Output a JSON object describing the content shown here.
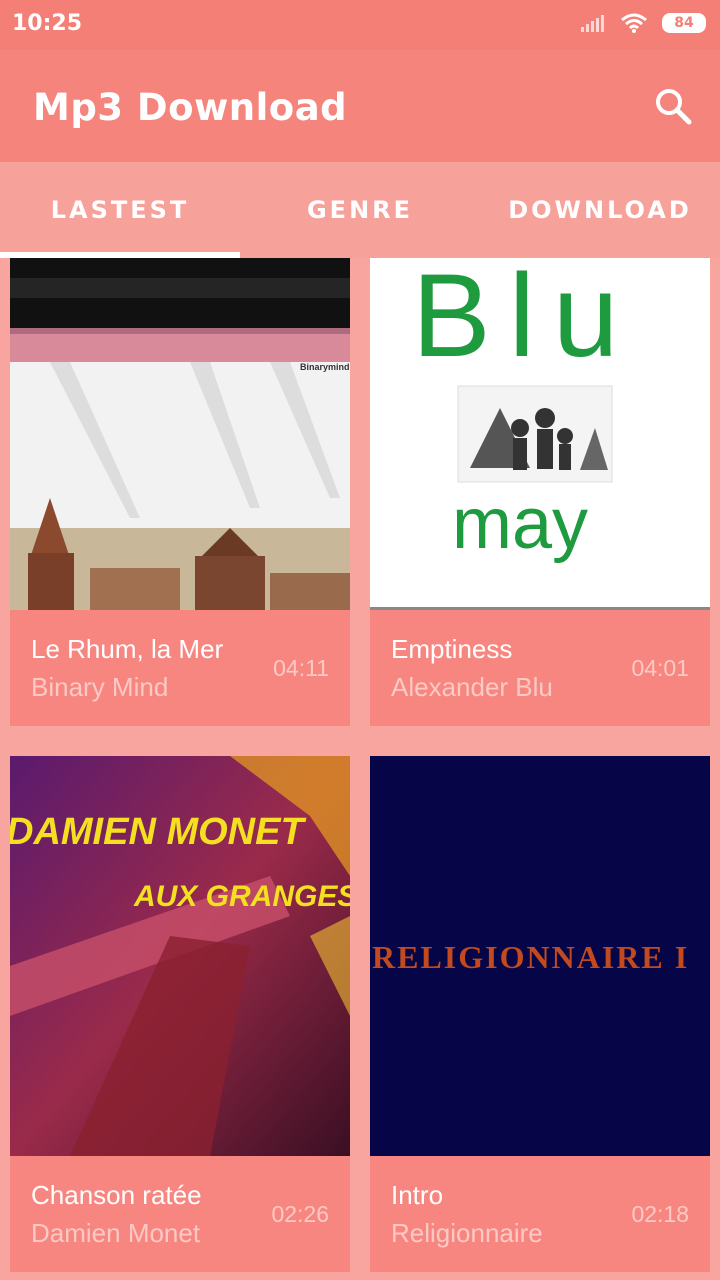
{
  "status": {
    "time": "10:25",
    "battery": "84"
  },
  "appbar": {
    "title": "Mp3 Download"
  },
  "tabs": [
    {
      "label": "LASTEST",
      "selected": true
    },
    {
      "label": "GENRE",
      "selected": false
    },
    {
      "label": "DOWNLOAD",
      "selected": false
    }
  ],
  "cards": [
    {
      "title": "Le Rhum, la Mer",
      "artist": "Binary Mind",
      "duration": "04:11",
      "cover_text": "Binarymind"
    },
    {
      "title": "Emptiness",
      "artist": "Alexander Blu",
      "duration": "04:01",
      "cover_text_top": "Blu",
      "cover_text_bottom": "may"
    },
    {
      "title": "Chanson ratée",
      "artist": "Damien Monet",
      "duration": "02:26",
      "cover_text_top": "DAMIEN MONET",
      "cover_text_bottom": "AUX GRANGES"
    },
    {
      "title": "Intro",
      "artist": "Religionnaire",
      "duration": "02:18",
      "cover_text": "RELIGIONNAIRE  I"
    }
  ],
  "colors": {
    "statusbar": "#F47F76",
    "appbar": "#F5847C",
    "tabs": "#F7A19B",
    "background": "#F8A5A0",
    "card_info": "#F88680"
  },
  "icons": {
    "search": "search-icon",
    "signal": "signal-icon",
    "wifi": "wifi-icon",
    "battery": "battery-icon"
  }
}
